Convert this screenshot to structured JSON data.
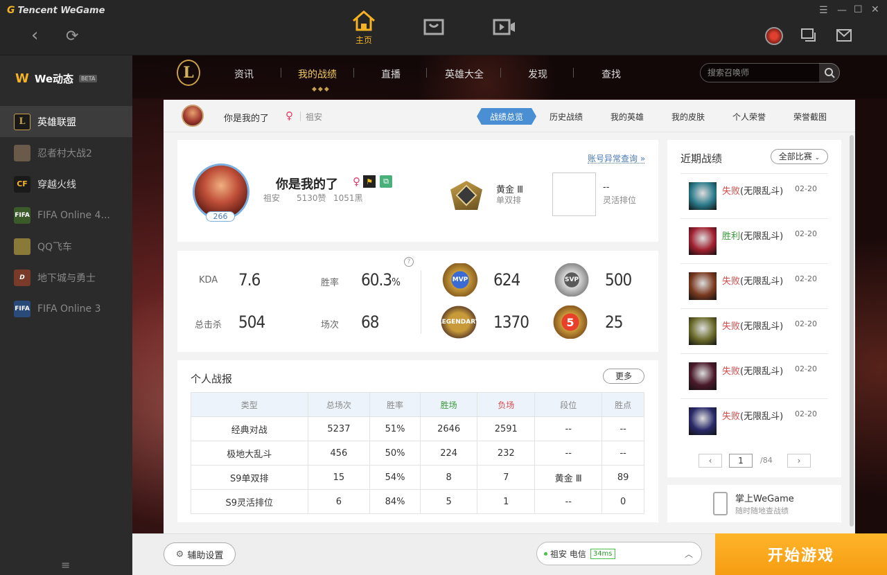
{
  "app": {
    "title": "Tencent WeGame"
  },
  "titlebar": {
    "home_label": "主页"
  },
  "sidebar": {
    "brand": "We动态",
    "beta": "BETA",
    "items": [
      {
        "label": "英雄联盟",
        "icon": "lol-icon"
      },
      {
        "label": "忍者村大战2",
        "icon": "ninja-icon"
      },
      {
        "label": "穿越火线",
        "icon": "crossfire-icon"
      },
      {
        "label": "FIFA Online 4...",
        "icon": "fifa4-icon"
      },
      {
        "label": "QQ飞车",
        "icon": "qqspeed-icon"
      },
      {
        "label": "地下城与勇士",
        "icon": "dnf-icon"
      },
      {
        "label": "FIFA Online 3",
        "icon": "fifa3-icon"
      }
    ]
  },
  "lolnav": {
    "items": [
      "资讯",
      "我的战绩",
      "直播",
      "英雄大全",
      "发现",
      "查找"
    ],
    "search_placeholder": "搜索召唤师"
  },
  "subnav": {
    "name": "你是我的了",
    "server": "祖安",
    "tabs": [
      "战绩总览",
      "历史战绩",
      "我的英雄",
      "我的皮肤",
      "个人荣誉",
      "荣誉截图"
    ]
  },
  "profile": {
    "name": "你是我的了",
    "level": "266",
    "server": "祖安",
    "likes": "5130赞",
    "blacks": "1051黑",
    "account_link": "账号异常查询 »",
    "rank_name": "黄金 Ⅲ",
    "rank_queue": "单双排",
    "flex_rank": "--",
    "flex_label": "灵活排位"
  },
  "stats": {
    "kda_label": "KDA",
    "kda": "7.6",
    "winrate_label": "胜率",
    "winrate": "60.3",
    "winrate_unit": "%",
    "kills_label": "总击杀",
    "kills": "504",
    "games_label": "场次",
    "games": "68",
    "mvp": "624",
    "svp": "500",
    "legendary": "1370",
    "penta": "25",
    "help": "?"
  },
  "report": {
    "title": "个人战报",
    "more": "更多",
    "headers": [
      "类型",
      "总场次",
      "胜率",
      "胜场",
      "负场",
      "段位",
      "胜点"
    ],
    "rows": [
      [
        "经典对战",
        "5237",
        "51%",
        "2646",
        "2591",
        "--",
        "--"
      ],
      [
        "极地大乱斗",
        "456",
        "50%",
        "224",
        "232",
        "--",
        "--"
      ],
      [
        "S9单双排",
        "15",
        "54%",
        "8",
        "7",
        "黄金 Ⅲ",
        "89"
      ],
      [
        "S9灵活排位",
        "6",
        "84%",
        "5",
        "1",
        "--",
        "0"
      ]
    ]
  },
  "recent": {
    "title": "近期战绩",
    "filter": "全部比赛",
    "matches": [
      {
        "result": "失败",
        "mode": "(无限乱斗)",
        "date": "02-20",
        "win": false,
        "color": "#2a7a8a"
      },
      {
        "result": "胜利",
        "mode": "(无限乱斗)",
        "date": "02-20",
        "win": true,
        "color": "#a02030"
      },
      {
        "result": "失败",
        "mode": "(无限乱斗)",
        "date": "02-20",
        "win": false,
        "color": "#7a3a20"
      },
      {
        "result": "失败",
        "mode": "(无限乱斗)",
        "date": "02-20",
        "win": false,
        "color": "#6a6a2a"
      },
      {
        "result": "失败",
        "mode": "(无限乱斗)",
        "date": "02-20",
        "win": false,
        "color": "#4a1a2a"
      },
      {
        "result": "失败",
        "mode": "(无限乱斗)",
        "date": "02-20",
        "win": false,
        "color": "#2a2a6a"
      }
    ],
    "page": "1",
    "total_pages": "/84"
  },
  "mobile": {
    "title": "掌上WeGame",
    "subtitle": "随时随地查战绩"
  },
  "bottom": {
    "assist": "辅助设置",
    "server": "祖安 电信",
    "ping": "34ms",
    "start": "开始游戏"
  }
}
